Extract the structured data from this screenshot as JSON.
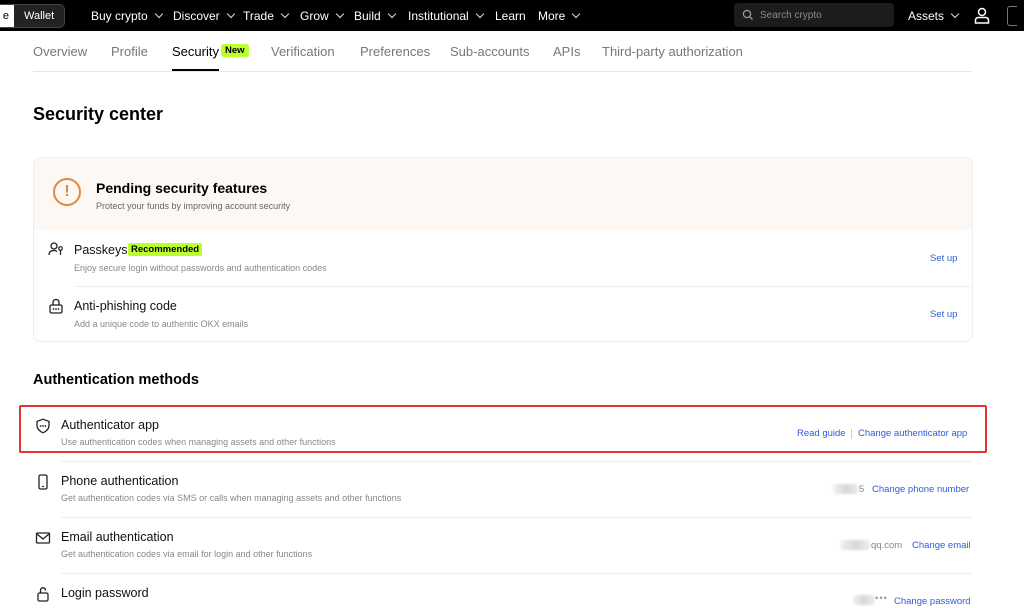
{
  "topbar": {
    "exchange_label": "e",
    "wallet_label": "Wallet",
    "nav": [
      {
        "label": "Buy crypto",
        "has_menu": true
      },
      {
        "label": "Discover",
        "has_menu": true
      },
      {
        "label": "Trade",
        "has_menu": true
      },
      {
        "label": "Grow",
        "has_menu": true
      },
      {
        "label": "Build",
        "has_menu": true
      },
      {
        "label": "Institutional",
        "has_menu": true
      },
      {
        "label": "Learn",
        "has_menu": false
      },
      {
        "label": "More",
        "has_menu": true
      }
    ],
    "search_placeholder": "Search crypto",
    "assets_label": "Assets"
  },
  "tabs": [
    {
      "label": "Overview"
    },
    {
      "label": "Profile"
    },
    {
      "label": "Security",
      "active": true,
      "badge": "New"
    },
    {
      "label": "Verification"
    },
    {
      "label": "Preferences"
    },
    {
      "label": "Sub-accounts"
    },
    {
      "label": "APIs"
    },
    {
      "label": "Third-party authorization"
    }
  ],
  "page_title": "Security center",
  "pending": {
    "title": "Pending security features",
    "subtitle": "Protect your funds by improving account security",
    "items": [
      {
        "title": "Passkeys",
        "badge": "Recommended",
        "desc": "Enjoy secure login without passwords and authentication codes",
        "action": "Set up",
        "icon": "passkey-icon"
      },
      {
        "title": "Anti-phishing code",
        "desc": "Add a unique code to authentic OKX emails",
        "action": "Set up",
        "icon": "anti-phishing-icon"
      }
    ]
  },
  "auth_section_title": "Authentication methods",
  "auth_methods": [
    {
      "title": "Authenticator app",
      "desc": "Use authentication codes when managing assets and other functions",
      "actions": [
        "Read guide",
        "Change authenticator app"
      ],
      "icon": "shield-icon"
    },
    {
      "title": "Phone authentication",
      "desc": "Get authentication codes via SMS or calls when managing assets and other functions",
      "value": "5",
      "actions": [
        "Change phone number"
      ],
      "icon": "phone-icon"
    },
    {
      "title": "Email authentication",
      "desc": "Get authentication codes via email for login and other functions",
      "value": "qq.com",
      "actions": [
        "Change email"
      ],
      "icon": "email-icon"
    },
    {
      "title": "Login password",
      "value": "•••",
      "actions": [
        "Change password"
      ],
      "icon": "lock-icon"
    }
  ],
  "colors": {
    "accent_green": "#bcff2f",
    "link_blue": "#2c5cd6",
    "warning_orange": "#e2873f",
    "highlight_red": "#e3342f"
  }
}
